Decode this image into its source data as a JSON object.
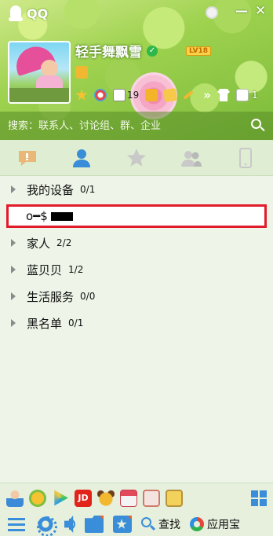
{
  "window": {
    "title": "QQ",
    "min_symbol": "—",
    "close_symbol": "✕"
  },
  "profile": {
    "nickname": "轻手舞飘雪",
    "verified_symbol": "✓",
    "level_badge": "LV18",
    "mail_count": "19",
    "more_symbol": "»",
    "extra_count": "1"
  },
  "search": {
    "placeholder": "搜索：联系人、讨论组、群、企业"
  },
  "tabs": [
    {
      "name": "messages"
    },
    {
      "name": "contacts",
      "active": true
    },
    {
      "name": "favorites"
    },
    {
      "name": "groups"
    },
    {
      "name": "devices"
    }
  ],
  "groups": [
    {
      "name": "我的设备",
      "count": "0/1"
    },
    {
      "name": "o━$",
      "count": ""
    },
    {
      "name": "家人",
      "count": "2/2"
    },
    {
      "name": "蓝贝贝",
      "count": "1/2"
    },
    {
      "name": "生活服务",
      "count": "0/0"
    },
    {
      "name": "黑名单",
      "count": "0/1"
    }
  ],
  "apps_bar": {
    "jd_label": "JD"
  },
  "toolbar": {
    "find_label": "查找",
    "appstore_label": "应用宝"
  },
  "colors": {
    "accent": "#3a8dd8",
    "highlight_border": "#e21b2b",
    "header_green": "#9ed24f"
  }
}
